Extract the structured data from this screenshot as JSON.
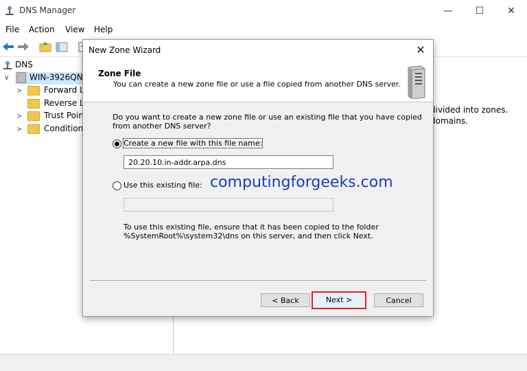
{
  "window": {
    "title": "DNS Manager"
  },
  "menu": [
    "File",
    "Action",
    "View",
    "Help"
  ],
  "tree": {
    "root": "DNS",
    "server": "WIN-3926QNR",
    "children": [
      "Forward Lo",
      "Reverse Lo",
      "Trust Point",
      "Conditiona"
    ]
  },
  "rightpane": {
    "line1": "divided into zones.",
    "line2": "domains."
  },
  "dialog": {
    "title": "New Zone Wizard",
    "header_title": "Zone File",
    "header_subtitle": "You can create a new zone file or use a file copied from another DNS server.",
    "question_line1": "Do you want to create a new zone file or use an existing file that you have copied",
    "question_line2": "from another DNS server?",
    "option_create": "Create a new file with this file name:",
    "create_value": "20.20.10.in-addr.arpa.dns",
    "option_existing": "Use this existing file:",
    "existing_value": "",
    "note_line1": "To use this existing file, ensure that it has been copied to the folder",
    "note_line2": "%SystemRoot%\\system32\\dns on this server, and then click Next.",
    "buttons": {
      "back": "< Back",
      "next": "Next >",
      "cancel": "Cancel"
    }
  },
  "watermark": "computingforgeeks.com"
}
